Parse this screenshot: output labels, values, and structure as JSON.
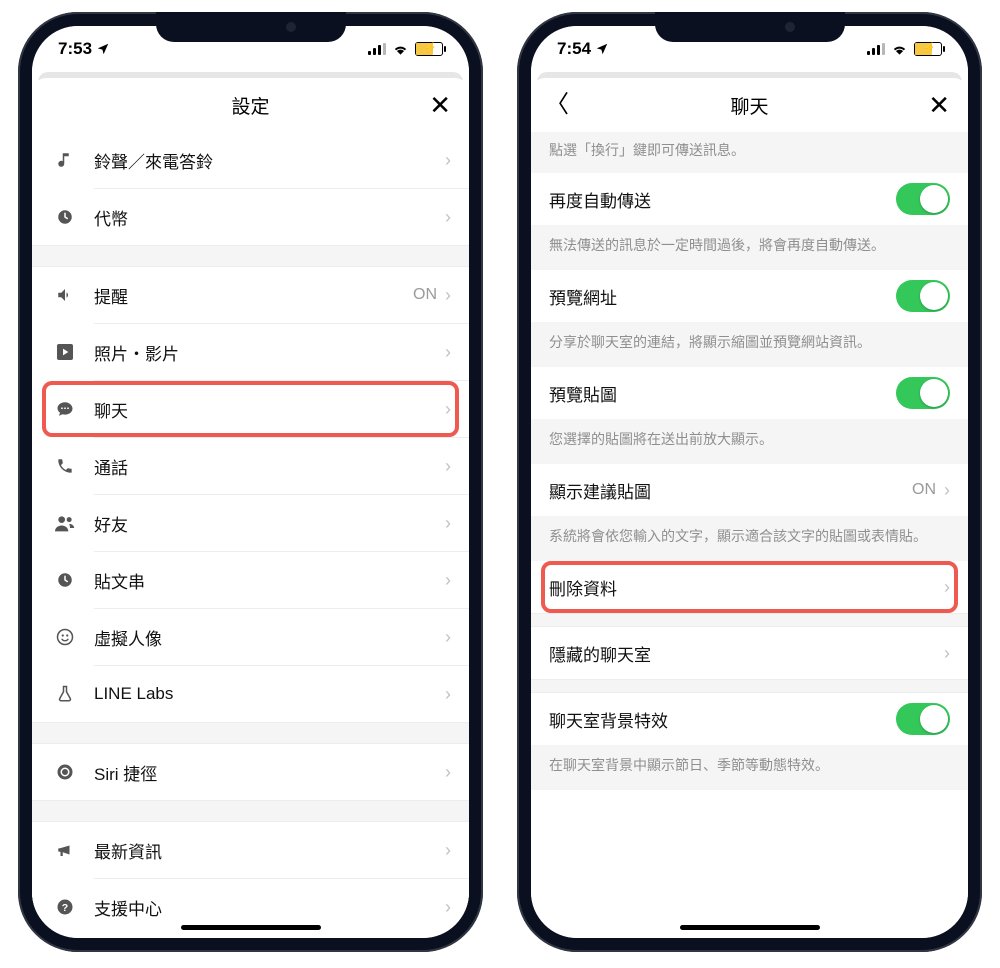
{
  "left": {
    "status_time": "7:53",
    "header_title": "設定",
    "rows_group1": [
      {
        "icon": "music-icon",
        "label": "鈴聲／來電答鈴"
      },
      {
        "icon": "clock-icon",
        "label": "代幣"
      }
    ],
    "rows_group2": [
      {
        "icon": "speaker-icon",
        "label": "提醒",
        "value": "ON"
      },
      {
        "icon": "play-icon",
        "label": "照片・影片"
      },
      {
        "icon": "chat-icon",
        "label": "聊天",
        "highlighted": true
      },
      {
        "icon": "phone-icon",
        "label": "通話"
      },
      {
        "icon": "friends-icon",
        "label": "好友"
      },
      {
        "icon": "timeline-icon",
        "label": "貼文串"
      },
      {
        "icon": "avatar-icon",
        "label": "虛擬人像"
      },
      {
        "icon": "labs-icon",
        "label": "LINE Labs"
      }
    ],
    "rows_group3": [
      {
        "icon": "siri-icon",
        "label": "Siri 捷徑"
      }
    ],
    "rows_group4": [
      {
        "icon": "megaphone-icon",
        "label": "最新資訊"
      },
      {
        "icon": "help-icon",
        "label": "支援中心"
      }
    ]
  },
  "right": {
    "status_time": "7:54",
    "header_title": "聊天",
    "hint_top": "點選「換行」鍵即可傳送訊息。",
    "items": [
      {
        "label": "再度自動傳送",
        "toggle": true,
        "desc": "無法傳送的訊息於一定時間過後，將會再度自動傳送。"
      },
      {
        "label": "預覽網址",
        "toggle": true,
        "desc": "分享於聊天室的連結，將顯示縮圖並預覽網站資訊。"
      },
      {
        "label": "預覽貼圖",
        "toggle": true,
        "desc": "您選擇的貼圖將在送出前放大顯示。"
      },
      {
        "label": "顯示建議貼圖",
        "value": "ON",
        "desc": "系統將會依您輸入的文字，顯示適合該文字的貼圖或表情貼。"
      },
      {
        "label": "刪除資料",
        "chev": true,
        "highlighted": true
      },
      {
        "label": "隱藏的聊天室",
        "chev": true
      },
      {
        "label": "聊天室背景特效",
        "toggle": true,
        "desc": "在聊天室背景中顯示節日、季節等動態特效。"
      }
    ]
  }
}
